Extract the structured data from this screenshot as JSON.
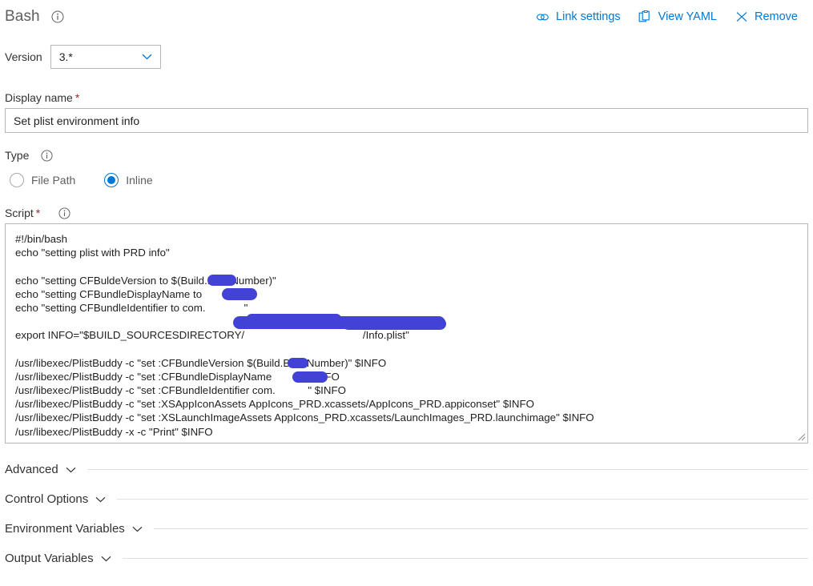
{
  "header": {
    "title": "Bash",
    "info_icon": "info-circle-icon",
    "actions": [
      {
        "label": "Link settings",
        "icon": "link-icon",
        "name": "link-settings-button"
      },
      {
        "label": "View YAML",
        "icon": "clipboard-icon",
        "name": "view-yaml-button"
      },
      {
        "label": "Remove",
        "icon": "close-x-icon",
        "name": "remove-button"
      }
    ]
  },
  "version": {
    "label": "Version",
    "value": "3.*",
    "chevron_icon": "chevron-down-icon"
  },
  "display_name": {
    "label": "Display name",
    "required_marker": "*",
    "value": "Set plist environment info",
    "placeholder": ""
  },
  "type": {
    "label": "Type",
    "info_icon": "info-circle-icon",
    "options": [
      {
        "label": "File Path",
        "checked": false
      },
      {
        "label": "Inline",
        "checked": true
      }
    ]
  },
  "script": {
    "label": "Script",
    "required_marker": "*",
    "info_icon": "info-circle-icon",
    "lines": [
      "#!/bin/bash",
      "echo \"setting plist with PRD info\"",
      "",
      "echo \"setting CFBuldeVersion to $(Build.BuildNumber)\"",
      "echo \"setting CFBundleDisplayName to            \"",
      "echo \"setting CFBundleIdentifier to com.             \"",
      "",
      "export INFO=\"$BUILD_SOURCESDIRECTORY/                                        /Info.plist\"",
      "",
      "/usr/libexec/PlistBuddy -c \"set :CFBundleVersion $(Build.BuildNumber)\" $INFO",
      "/usr/libexec/PlistBuddy -c \"set :CFBundleDisplayName          \" $INFO",
      "/usr/libexec/PlistBuddy -c \"set :CFBundleIdentifier com.           \" $INFO",
      "/usr/libexec/PlistBuddy -c \"set :XSAppIconAssets AppIcons_PRD.xcassets/AppIcons_PRD.appiconset\" $INFO",
      "/usr/libexec/PlistBuddy -c \"set :XSLaunchImageAssets AppIcons_PRD.xcassets/LaunchImages_PRD.launchimage\" $INFO",
      "/usr/libexec/PlistBuddy -x -c \"Print\" $INFO"
    ],
    "redaction_color": "#4242d6",
    "resize_handle": "resize-grip-icon"
  },
  "sections": [
    {
      "label": "Advanced",
      "name": "section-advanced",
      "chevron_icon": "chevron-down-icon"
    },
    {
      "label": "Control Options",
      "name": "section-control-options",
      "chevron_icon": "chevron-down-icon"
    },
    {
      "label": "Environment Variables",
      "name": "section-environment-variables",
      "chevron_icon": "chevron-down-icon"
    },
    {
      "label": "Output Variables",
      "name": "section-output-variables",
      "chevron_icon": "chevron-down-icon"
    }
  ],
  "colors": {
    "accent": "#0078d4",
    "required": "#a4262c",
    "border": "#b7b7b7",
    "divider": "#e1dfdd",
    "text": "#323130"
  }
}
